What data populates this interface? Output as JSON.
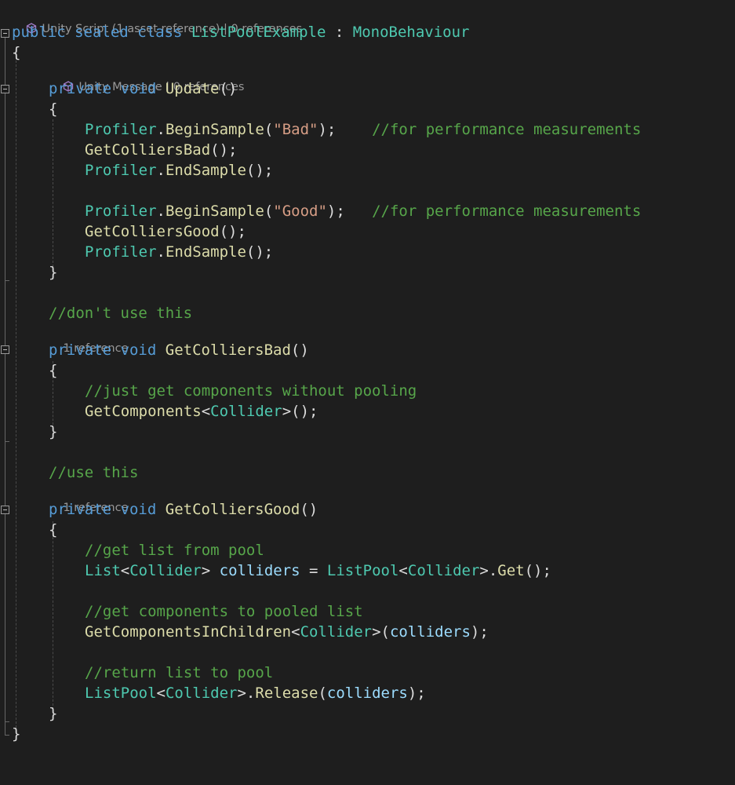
{
  "codelens": {
    "class_lens": "Unity Script (1 asset reference) | 0 references",
    "update_lens": "Unity Message | 0 references",
    "bad_lens": "1 reference",
    "good_lens": "1 reference"
  },
  "colors": {
    "background": "#1e1e1e",
    "keyword": "#569cd6",
    "type": "#4ec9b0",
    "method": "#dcdcaa",
    "string": "#d69d85",
    "comment": "#57a64a",
    "variable": "#9cdcfe",
    "punctuation": "#dcdcdc",
    "codelens": "#999999",
    "unity_icon": "#a07cc8"
  },
  "icons": {
    "unity_icon": "unity-cube-icon",
    "fold_icon": "collapse-minus-icon"
  },
  "code": {
    "l1": {
      "t1": "public",
      "t2": " ",
      "t3": "sealed",
      "t4": " ",
      "t5": "class",
      "t6": " ",
      "t7": "ListPoolExample",
      "t8": " : ",
      "t9": "MonoBehaviour"
    },
    "l2": {
      "t1": "{"
    },
    "l3": {
      "t1": "private",
      "t2": " ",
      "t3": "void",
      "t4": " ",
      "t5": "Update",
      "t6": "()"
    },
    "l4": {
      "t1": "{"
    },
    "l5": {
      "t1": "Profiler",
      "t2": ".",
      "t3": "BeginSample",
      "t4": "(",
      "t5": "\"Bad\"",
      "t6": ");    ",
      "t7": "//for performance measurements"
    },
    "l6": {
      "t1": "GetColliersBad",
      "t2": "();"
    },
    "l7": {
      "t1": "Profiler",
      "t2": ".",
      "t3": "EndSample",
      "t4": "();"
    },
    "l8": {
      "t1": "Profiler",
      "t2": ".",
      "t3": "BeginSample",
      "t4": "(",
      "t5": "\"Good\"",
      "t6": ");   ",
      "t7": "//for performance measurements"
    },
    "l9": {
      "t1": "GetColliersGood",
      "t2": "();"
    },
    "l10": {
      "t1": "Profiler",
      "t2": ".",
      "t3": "EndSample",
      "t4": "();"
    },
    "l11": {
      "t1": "}"
    },
    "l12": {
      "t1": "//don't use this"
    },
    "l13": {
      "t1": "private",
      "t2": " ",
      "t3": "void",
      "t4": " ",
      "t5": "GetColliersBad",
      "t6": "()"
    },
    "l14": {
      "t1": "{"
    },
    "l15": {
      "t1": "//just get components without pooling"
    },
    "l16": {
      "t1": "GetComponents",
      "t2": "<",
      "t3": "Collider",
      "t4": ">();"
    },
    "l17": {
      "t1": "}"
    },
    "l18": {
      "t1": "//use this"
    },
    "l19": {
      "t1": "private",
      "t2": " ",
      "t3": "void",
      "t4": " ",
      "t5": "GetColliersGood",
      "t6": "()"
    },
    "l20": {
      "t1": "{"
    },
    "l21": {
      "t1": "//get list from pool"
    },
    "l22": {
      "t1": "List",
      "t2": "<",
      "t3": "Collider",
      "t4": "> ",
      "t5": "colliders",
      "t6": " = ",
      "t7": "ListPool",
      "t8": "<",
      "t9": "Collider",
      "t10": ">.",
      "t11": "Get",
      "t12": "();"
    },
    "l23": {
      "t1": "//get components to pooled list"
    },
    "l24": {
      "t1": "GetComponentsInChildren",
      "t2": "<",
      "t3": "Collider",
      "t4": ">(",
      "t5": "colliders",
      "t6": ");"
    },
    "l25": {
      "t1": "//return list to pool"
    },
    "l26": {
      "t1": "ListPool",
      "t2": "<",
      "t3": "Collider",
      "t4": ">.",
      "t5": "Release",
      "t6": "(",
      "t7": "colliders",
      "t8": ");"
    },
    "l27": {
      "t1": "}"
    },
    "l28": {
      "t1": "}"
    }
  }
}
